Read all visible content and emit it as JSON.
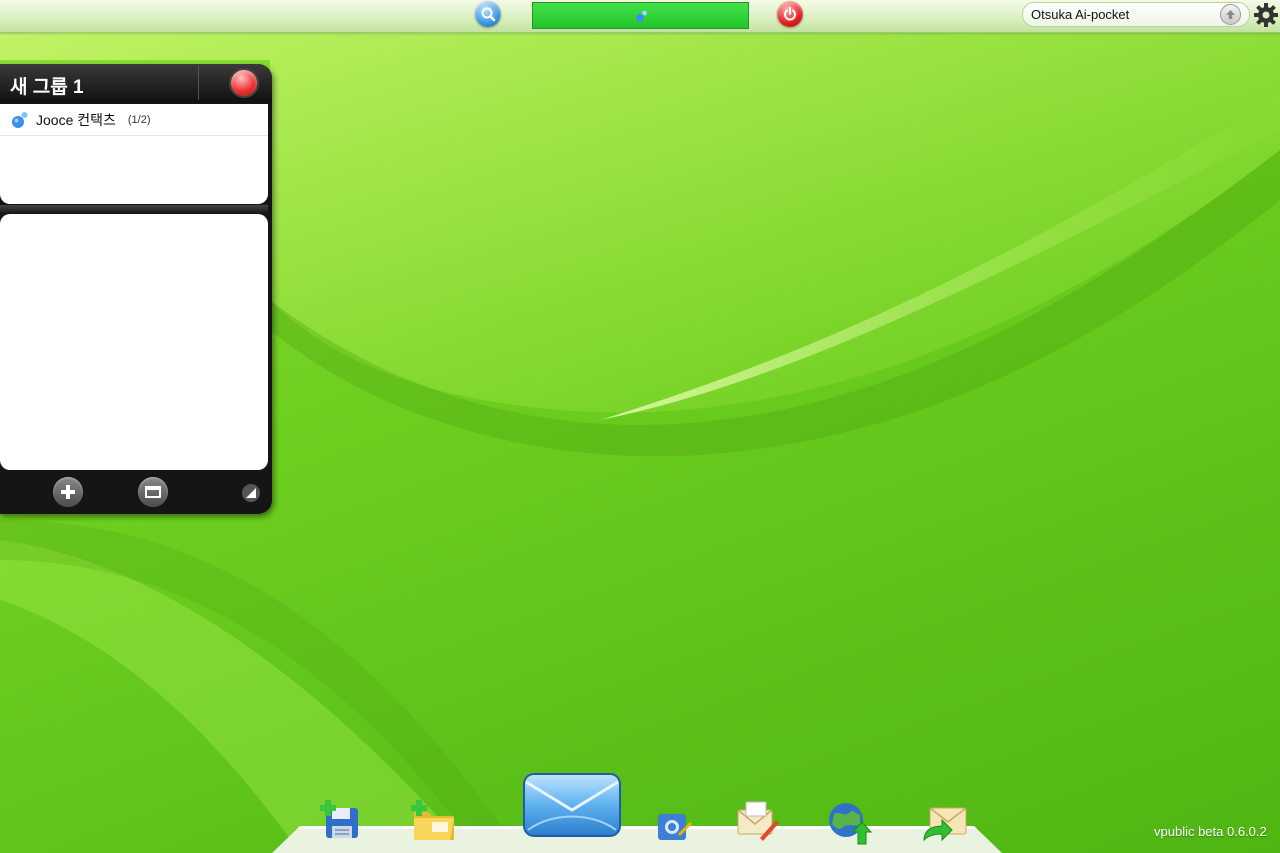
{
  "topbar": {
    "account_name": "Otsuka Ai-pocket"
  },
  "group_widget": {
    "title": "새 그룹 1",
    "contact": {
      "name": "Jooce 컨택츠",
      "count": "(1/2)"
    }
  },
  "footer": {
    "version": "vpublic beta 0.6.0.2"
  },
  "icons": {
    "search": "search-icon",
    "power": "power-icon",
    "status": "user-status-icon",
    "upload": "upload-arrow-icon",
    "settings": "gear-icon",
    "close": "close-icon",
    "add": "plus-icon",
    "window": "window-icon",
    "resize": "resize-icon"
  },
  "dock": {
    "items": [
      "save-new-icon",
      "new-folder-icon",
      "mail-app-icon",
      "photo-upload-icon",
      "compose-mail-icon",
      "web-upload-icon",
      "mail-forward-icon"
    ]
  },
  "colors": {
    "wallpaper": "#6fcf1f",
    "status_bar": "#2ad032",
    "power": "#e01d1d",
    "search": "#3d95e0"
  }
}
